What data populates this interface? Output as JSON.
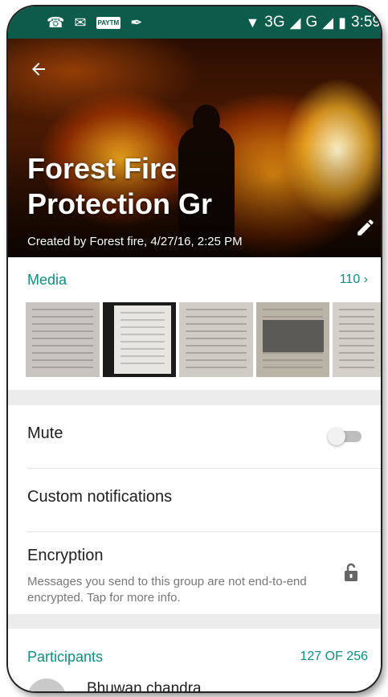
{
  "status_bar": {
    "left_icons": [
      "missed-call-icon",
      "gmail-icon",
      "paytm-icon",
      "cleaner-icon"
    ],
    "paytm_label": "PAYTM",
    "network": "3G",
    "signal_label": "G",
    "time": "3:59"
  },
  "header": {
    "title": "Forest Fire Protection Gr",
    "created_by": "Created by Forest fire, 4/27/16, 2:25 PM",
    "back_icon": "arrow-left-icon",
    "edit_icon": "pencil-icon"
  },
  "media": {
    "title": "Media",
    "count": "110",
    "thumbnails": [
      "document-scan",
      "document-on-dark",
      "form-document",
      "newspaper-clipping",
      "document-scan"
    ]
  },
  "settings": {
    "mute_label": "Mute",
    "mute_enabled": false,
    "custom_notifications_label": "Custom notifications",
    "encryption_label": "Encryption",
    "encryption_desc": "Messages you send to this group are not end-to-end encrypted. Tap for more info."
  },
  "participants": {
    "title": "Participants",
    "count": "127 OF 256",
    "list": [
      {
        "name": "Bhuwan chandra"
      }
    ]
  },
  "colors": {
    "accent": "#128c7e",
    "status_bar": "#0d5b4b"
  }
}
